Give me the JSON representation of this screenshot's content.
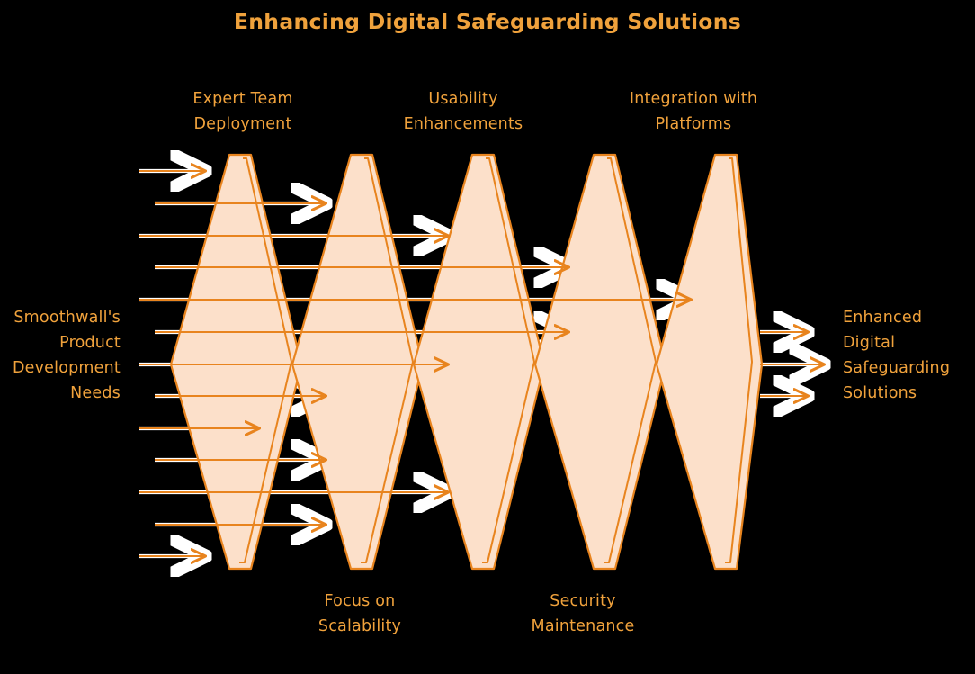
{
  "title": "Enhancing Digital Safeguarding Solutions",
  "theme": {
    "background": "#000000",
    "text_color": "#F0A23C",
    "shape_fill": "#FCE0CA",
    "shape_stroke": "#E8841E",
    "arrow_color": "#E8841E",
    "arrow_halo": "#FFFFFF"
  },
  "diagram": {
    "type": "fishbone-chevron-process",
    "input_label": "Smoothwall's\nProduct\nDevelopment\nNeeds",
    "output_label": "Enhanced\nDigital\nSafeguarding\nSolutions",
    "stages_top": [
      {
        "label": "Expert Team\nDeployment"
      },
      {
        "label": "Usability\nEnhancements"
      },
      {
        "label": "Integration with\nPlatforms"
      }
    ],
    "stages_bottom": [
      {
        "label": "Focus on\nScalability"
      },
      {
        "label": "Security\nMaintenance"
      }
    ],
    "input_arrow_count": 13,
    "output_arrow_count": 3,
    "diamond_count": 5
  }
}
